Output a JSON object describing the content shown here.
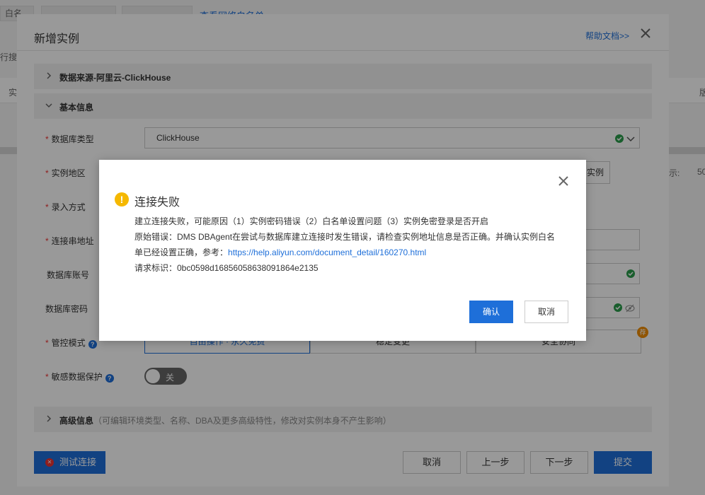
{
  "background": {
    "tabs": [
      "白名",
      "",
      "",
      "查看网络白名单"
    ],
    "left_fragments": [
      "行搜",
      "实",
      "示:",
      "50"
    ],
    "right_fragment": "版"
  },
  "main_dialog": {
    "title": "新增实例",
    "help_link": "帮助文档>>",
    "sections": {
      "data_source": "数据来源-阿里云-ClickHouse",
      "basic_info": "基本信息",
      "advanced_info": "高级信息",
      "advanced_hint": "（可编辑环境类型、名称、DBA及更多高级特性，修改对实例本身不产生影响）"
    },
    "fields": {
      "db_type_label": "数据库类型",
      "db_type_value": "ClickHouse",
      "region_label": "实例地区",
      "region_btn": "实例",
      "entry_mode_label": "录入方式",
      "conn_addr_label": "连接串地址",
      "db_account_label": "数据库账号",
      "db_password_label": "数据库密码",
      "control_mode_label": "管控模式",
      "control_modes": [
        "自由操作 · 永久免费",
        "稳定变更",
        "安全协同"
      ],
      "recommend_badge": "荐",
      "sensitive_label": "敏感数据保护",
      "toggle_text": "关"
    },
    "footer": {
      "test_conn": "测试连接",
      "cancel": "取消",
      "prev": "上一步",
      "next": "下一步",
      "submit": "提交"
    }
  },
  "error_dialog": {
    "title": "连接失败",
    "line1": "建立连接失败，可能原因（1）实例密码错误（2）白名单设置问题（3）实例免密登录是否开启",
    "line2": "原始错误：DMS DBAgent在尝试与数据库建立连接时发生错误，请检查实例地址信息是否正确。并确认实例白名",
    "line3_prefix": "单已经设置正确，参考：",
    "link": "https://help.aliyun.com/document_detail/160270.html",
    "line4": "请求标识：0bc0598d16856058638091864e2135",
    "ok": "确认",
    "cancel": "取消"
  },
  "colors": {
    "primary": "#1e6fd9",
    "warning": "#f5b800",
    "success": "#2a9d4b",
    "danger": "#e33333"
  }
}
